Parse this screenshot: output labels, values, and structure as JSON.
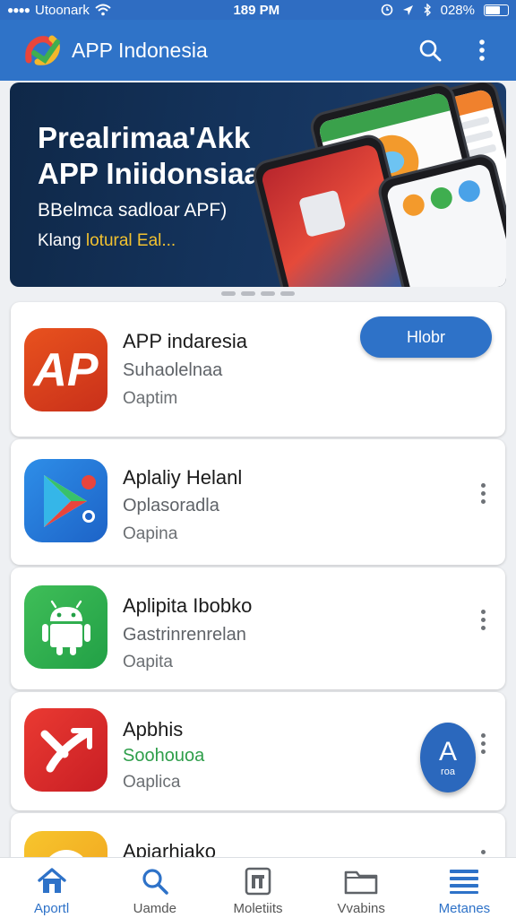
{
  "status_bar": {
    "carrier": "Utoonark",
    "time": "189 PM",
    "battery": "028%"
  },
  "app_bar": {
    "title": "APP Indonesia",
    "search_icon": "search-icon",
    "more_icon": "more-vert-icon"
  },
  "banner": {
    "title": "Prealrimaa'Akk APP Iniidonsiaa",
    "subtitle": "BBelmca sadloar APF)",
    "tag_prefix": "Klang",
    "tag_highlight": "lotural Eal..."
  },
  "apps": [
    {
      "name": "APP indaresia",
      "category": "Suhaolelnaa",
      "option": "Oaptim",
      "action": "Hlobr",
      "icon": "ap-logo-icon"
    },
    {
      "name": "Aplaliy Helanl",
      "category": "Oplasoradla",
      "option": "Oapina",
      "icon": "play-store-icon"
    },
    {
      "name": "Aplipita Ibobko",
      "category": "Gastrinrenrelan",
      "option": "Oapita",
      "icon": "android-icon"
    },
    {
      "name": "Apbhis",
      "category": "Soohouoa",
      "option": "Oaplica",
      "icon": "red-app-icon"
    },
    {
      "name": "Apiarhiako",
      "icon": "yellow-app-icon"
    }
  ],
  "fab": {
    "letter": "A",
    "label": "roa"
  },
  "bottom_nav": [
    {
      "label": "Aportl",
      "icon": "home-icon",
      "active": true
    },
    {
      "label": "Uamde",
      "icon": "search-icon"
    },
    {
      "label": "Moletiits",
      "icon": "apps-icon"
    },
    {
      "label": "Vvabins",
      "icon": "folder-icon"
    },
    {
      "label": "Metanes",
      "icon": "menu-icon"
    }
  ],
  "colors": {
    "primary": "#2f73c8",
    "banner_bg": "#14335c",
    "highlight": "#f2c230",
    "category_green": "#2e9e4a"
  }
}
